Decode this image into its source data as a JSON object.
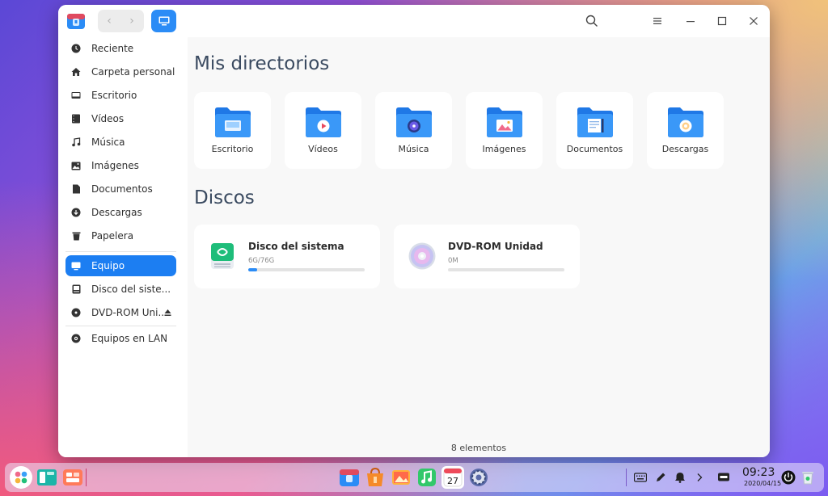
{
  "window": {
    "title_icon": "file-manager-icon",
    "nav_back": "‹",
    "nav_forward": "›"
  },
  "sidebar": {
    "items": [
      {
        "label": "Reciente",
        "icon": "clock-icon"
      },
      {
        "label": "Carpeta personal",
        "icon": "home-icon"
      },
      {
        "label": "Escritorio",
        "icon": "desktop-icon"
      },
      {
        "label": "Vídeos",
        "icon": "video-icon"
      },
      {
        "label": "Música",
        "icon": "music-icon"
      },
      {
        "label": "Imágenes",
        "icon": "image-icon"
      },
      {
        "label": "Documentos",
        "icon": "document-icon"
      },
      {
        "label": "Descargas",
        "icon": "download-icon"
      },
      {
        "label": "Papelera",
        "icon": "trash-icon"
      },
      {
        "label": "Equipo",
        "icon": "computer-icon"
      },
      {
        "label": "Disco del siste...",
        "icon": "disk-icon"
      },
      {
        "label": "DVD-ROM Uni...",
        "icon": "dvd-icon"
      },
      {
        "label": "Equipos en LAN",
        "icon": "network-icon"
      }
    ],
    "active_index": 9
  },
  "main": {
    "dirs_title": "Mis directorios",
    "folders": [
      {
        "label": "Escritorio",
        "icon": "desktop-folder-icon"
      },
      {
        "label": "Vídeos",
        "icon": "videos-folder-icon"
      },
      {
        "label": "Música",
        "icon": "music-folder-icon"
      },
      {
        "label": "Imágenes",
        "icon": "pictures-folder-icon"
      },
      {
        "label": "Documentos",
        "icon": "documents-folder-icon"
      },
      {
        "label": "Descargas",
        "icon": "downloads-folder-icon"
      }
    ],
    "disks_title": "Discos",
    "disks": [
      {
        "name": "Disco del sistema",
        "size": "6G/76G",
        "usage_fraction": 0.079,
        "icon": "system-disk-icon"
      },
      {
        "name": "DVD-ROM Unidad",
        "size": "0M",
        "usage_fraction": 0,
        "icon": "dvd-disc-icon"
      }
    ],
    "status": "8 elementos"
  },
  "taskbar": {
    "time": "09:23",
    "date": "2020/04/15"
  },
  "colors": {
    "accent": "#1c7ef2",
    "folder_blue": "#2b8cf6"
  }
}
